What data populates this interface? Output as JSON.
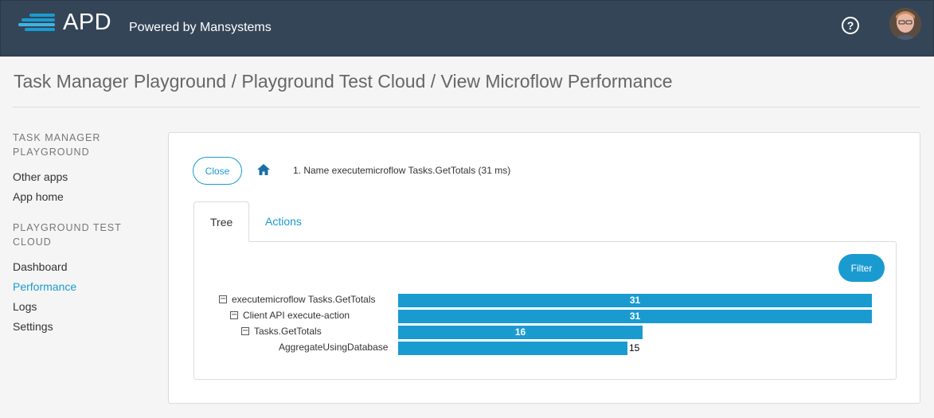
{
  "header": {
    "logo_text": "APD",
    "powered_by": "Powered by Mansystems",
    "help_icon": "question-circle-icon",
    "avatar_icon": "user-avatar"
  },
  "page": {
    "title": "Task Manager Playground / Playground Test Cloud / View Microflow Performance"
  },
  "sidebar": {
    "section1_title": "TASK MANAGER PLAYGROUND",
    "section1_items": [
      "Other apps",
      "App home"
    ],
    "section2_title": "PLAYGROUND TEST CLOUD",
    "section2_items": [
      "Dashboard",
      "Performance",
      "Logs",
      "Settings"
    ],
    "active_item": "Performance"
  },
  "panel": {
    "close_label": "Close",
    "home_icon": "home-icon",
    "breadcrumb": "1. Name executemicroflow Tasks.GetTotals (31 ms)",
    "tabs": [
      "Tree",
      "Actions"
    ],
    "active_tab": "Tree",
    "filter_label": "Filter"
  },
  "tree": {
    "max_value": 31,
    "rows": [
      {
        "label": "executemicroflow Tasks.GetTotals",
        "value": "31",
        "depth": 0,
        "toggle": "⊟"
      },
      {
        "label": "Client API execute-action",
        "value": "31",
        "depth": 1,
        "toggle": "⊟"
      },
      {
        "label": "Tasks.GetTotals",
        "value": "16",
        "depth": 2,
        "toggle": "⊟"
      },
      {
        "label": "AggregateUsingDatabase",
        "value": "15",
        "depth": 3,
        "toggle": ""
      }
    ]
  },
  "colors": {
    "topbar": "#344558",
    "accent": "#1a9bd0"
  }
}
